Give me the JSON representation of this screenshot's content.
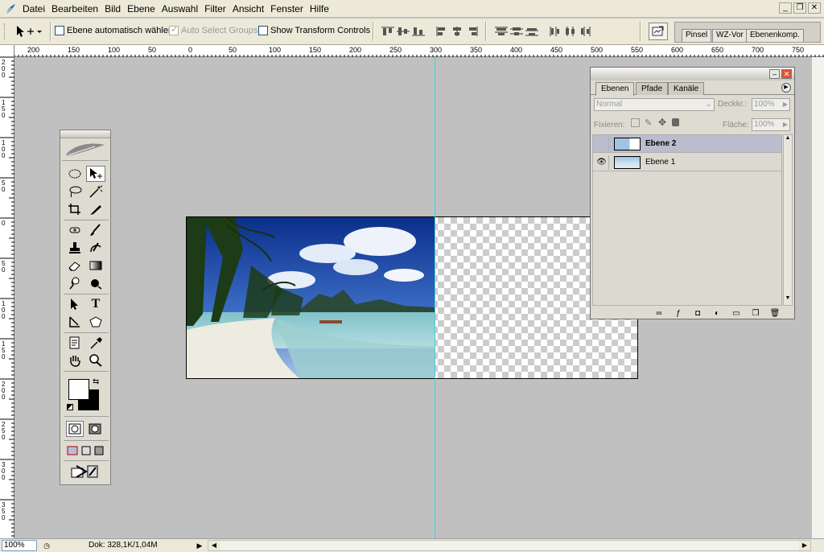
{
  "menu": {
    "items": [
      "Datei",
      "Bearbeiten",
      "Bild",
      "Ebene",
      "Auswahl",
      "Filter",
      "Ansicht",
      "Fenster",
      "Hilfe"
    ],
    "window_controls": [
      "_",
      "❐",
      "✕"
    ]
  },
  "options": {
    "auto_select_layer": {
      "label": "Ebene automatisch wählen",
      "checked": false
    },
    "auto_select_groups": {
      "label": "Auto Select Groups",
      "checked": true,
      "disabled": true
    },
    "show_transform_controls": {
      "label": "Show Transform Controls",
      "checked": false
    },
    "palette_well_tabs": [
      "Pinsel",
      "WZ-Vor",
      "Ebenenkomp."
    ]
  },
  "rulers": {
    "top_labels": [
      "200",
      "150",
      "100",
      "50",
      "0",
      "50",
      "100",
      "150",
      "200",
      "250",
      "300",
      "350",
      "400",
      "450",
      "500",
      "550",
      "600",
      "650",
      "700",
      "750"
    ],
    "left_labels": [
      "200",
      "150",
      "100",
      "50",
      "0",
      "50",
      "100",
      "150",
      "200",
      "250",
      "300",
      "350"
    ]
  },
  "layers_panel": {
    "tabs": [
      "Ebenen",
      "Pfade",
      "Kanäle"
    ],
    "active_tab": "Ebenen",
    "blend_mode": "Normal",
    "opacity_label": "Deckkr.:",
    "opacity_value": "100%",
    "lock_label": "Fixieren:",
    "fill_label": "Fläche:",
    "fill_value": "100%",
    "layers": [
      {
        "name": "Ebene 2",
        "visible": false,
        "selected": true
      },
      {
        "name": "Ebene 1",
        "visible": true,
        "selected": false
      }
    ]
  },
  "status": {
    "zoom": "100%",
    "doc_info": "Dok: 328,1K/1,04M"
  },
  "colors": {
    "guide": "#43cfd6",
    "selected_layer": "#bcbccf",
    "foreground": "#ffffff",
    "background": "#000000"
  },
  "icons": {
    "app": "feather-icon",
    "tools": [
      "elliptical-marquee-icon",
      "move-icon",
      "lasso-icon",
      "magic-wand-icon",
      "crop-icon",
      "slice-icon",
      "healing-brush-icon",
      "brush-icon",
      "clone-stamp-icon",
      "history-brush-icon",
      "eraser-icon",
      "gradient-icon",
      "dodge-icon",
      "burn-icon",
      "path-select-icon",
      "type-icon",
      "pen-icon",
      "shape-icon",
      "notes-icon",
      "eyedropper-icon",
      "hand-icon",
      "zoom-icon"
    ]
  }
}
